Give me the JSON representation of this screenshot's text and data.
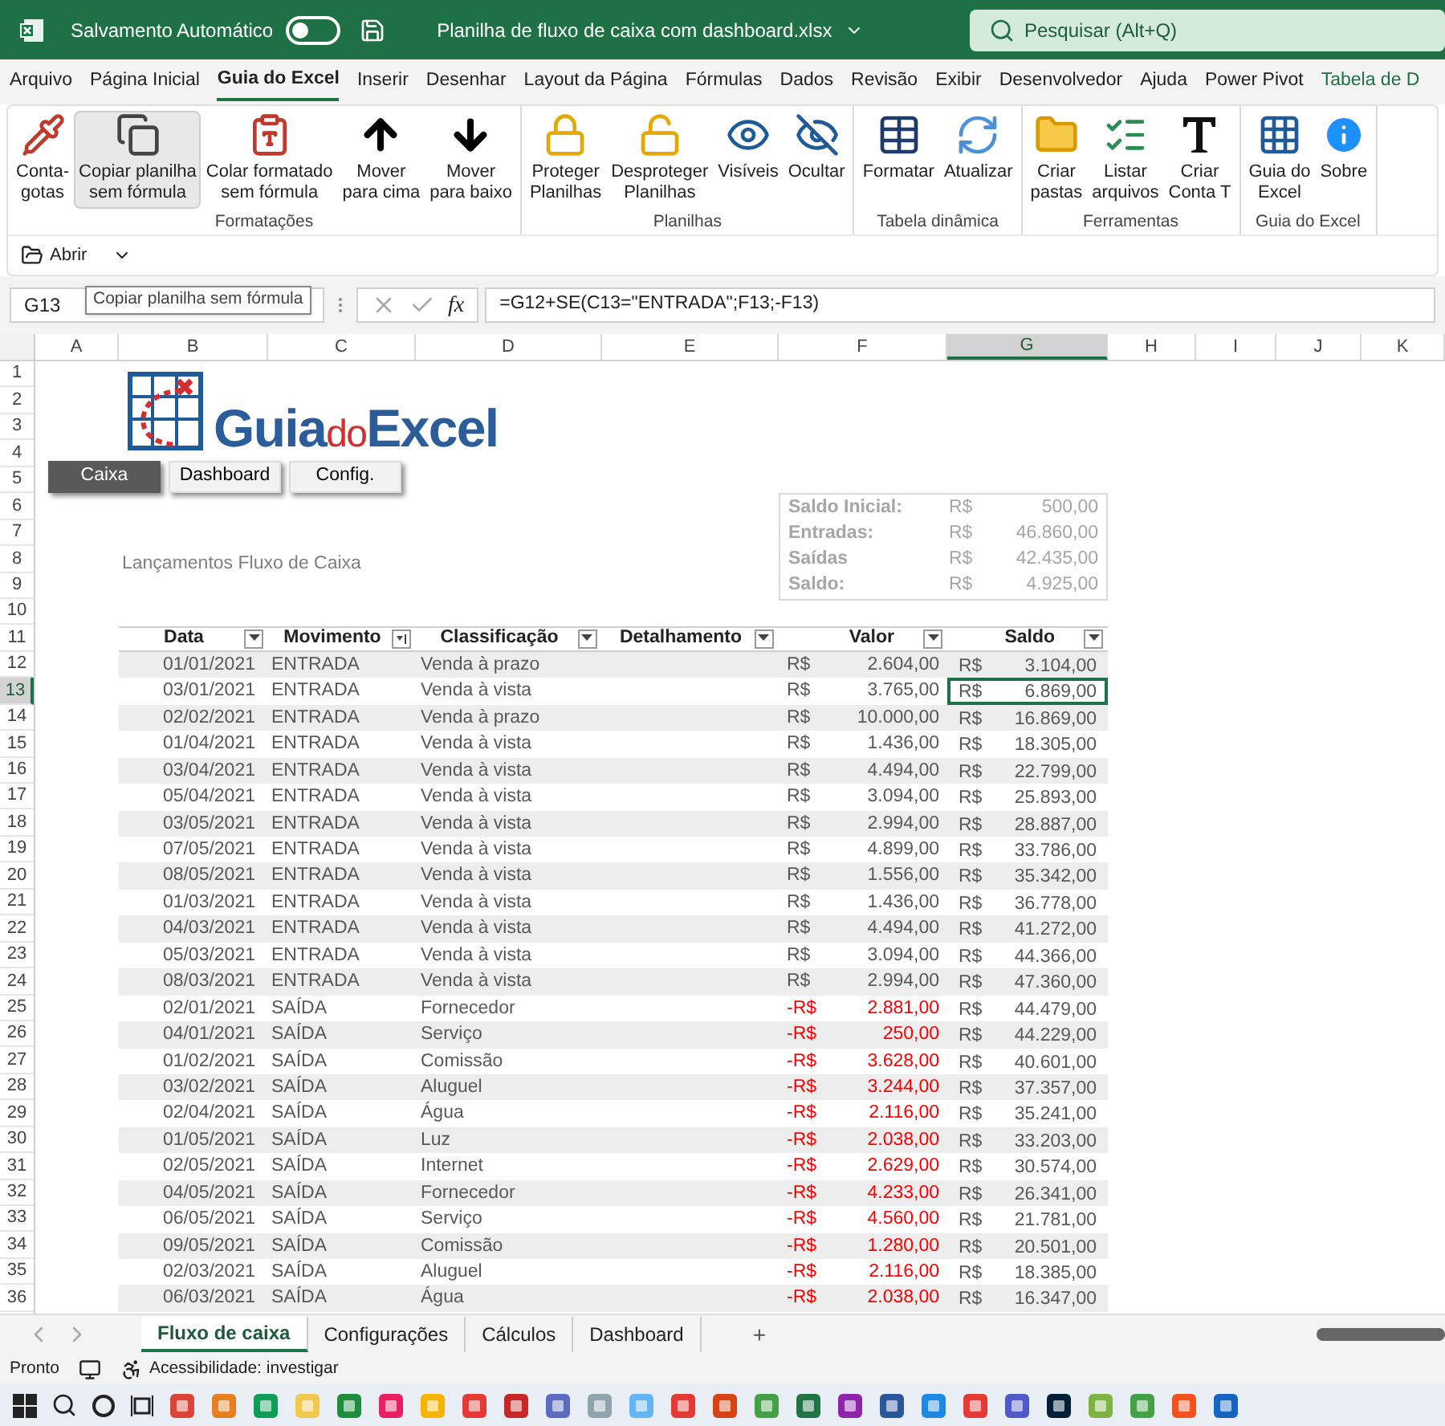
{
  "title_bar": {
    "autosave_label": "Salvamento Automático",
    "autosave_on": false,
    "file_title": "Planilha de fluxo de caixa com dashboard.xlsx",
    "search": {
      "placeholder": "Pesquisar (Alt+Q)"
    }
  },
  "menu_tabs": [
    {
      "label": "Arquivo",
      "selected": false,
      "kind": "normal"
    },
    {
      "label": "Página Inicial",
      "selected": false,
      "kind": "normal"
    },
    {
      "label": "Guia do Excel",
      "selected": true,
      "kind": "normal"
    },
    {
      "label": "Inserir",
      "selected": false,
      "kind": "normal"
    },
    {
      "label": "Desenhar",
      "selected": false,
      "kind": "normal"
    },
    {
      "label": "Layout da Página",
      "selected": false,
      "kind": "normal"
    },
    {
      "label": "Fórmulas",
      "selected": false,
      "kind": "normal"
    },
    {
      "label": "Dados",
      "selected": false,
      "kind": "normal"
    },
    {
      "label": "Revisão",
      "selected": false,
      "kind": "normal"
    },
    {
      "label": "Exibir",
      "selected": false,
      "kind": "normal"
    },
    {
      "label": "Desenvolvedor",
      "selected": false,
      "kind": "normal"
    },
    {
      "label": "Ajuda",
      "selected": false,
      "kind": "normal"
    },
    {
      "label": "Power Pivot",
      "selected": false,
      "kind": "normal"
    },
    {
      "label": "Tabela de D",
      "selected": false,
      "kind": "contextual"
    }
  ],
  "ribbon_groups": [
    {
      "name": "Formatações",
      "buttons": [
        {
          "lines": [
            "Conta-",
            "gotas"
          ],
          "highlighted": false
        },
        {
          "lines": [
            "Copiar planilha",
            "sem fórmula"
          ],
          "highlighted": true
        },
        {
          "lines": [
            "Colar formatado",
            "sem fórmula"
          ],
          "highlighted": false
        },
        {
          "lines": [
            "Mover",
            "para cima"
          ],
          "highlighted": false
        },
        {
          "lines": [
            "Mover",
            "para baixo"
          ],
          "highlighted": false
        }
      ]
    },
    {
      "name": "Planilhas",
      "buttons": [
        {
          "lines": [
            "Proteger",
            "Planilhas"
          ],
          "highlighted": false
        },
        {
          "lines": [
            "Desproteger",
            "Planilhas"
          ],
          "highlighted": false
        },
        {
          "lines": [
            "Visíveis"
          ],
          "highlighted": false
        },
        {
          "lines": [
            "Ocultar"
          ],
          "highlighted": false
        }
      ]
    },
    {
      "name": "Tabela dinâmica",
      "buttons": [
        {
          "lines": [
            "Formatar"
          ],
          "highlighted": false
        },
        {
          "lines": [
            "Atualizar"
          ],
          "highlighted": false
        }
      ]
    },
    {
      "name": "Ferramentas",
      "buttons": [
        {
          "lines": [
            "Criar",
            "pastas"
          ],
          "highlighted": false
        },
        {
          "lines": [
            "Listar",
            "arquivos"
          ],
          "highlighted": false
        },
        {
          "lines": [
            "Criar",
            "Conta T"
          ],
          "highlighted": false
        }
      ]
    },
    {
      "name": "Guia do Excel",
      "buttons": [
        {
          "lines": [
            "Guia do",
            "Excel"
          ],
          "highlighted": false
        },
        {
          "lines": [
            "Sobre"
          ],
          "highlighted": false
        }
      ]
    }
  ],
  "quick_access": {
    "open_label": "Abrir"
  },
  "tooltip": "Copiar planilha sem fórmula",
  "formula_bar": {
    "name_box": "G13",
    "fx": "fx",
    "formula": "=G12+SE(C13=\"ENTRADA\";F13;-F13)"
  },
  "columns": [
    {
      "label": "A",
      "selected": false
    },
    {
      "label": "B",
      "selected": false
    },
    {
      "label": "C",
      "selected": false
    },
    {
      "label": "D",
      "selected": false
    },
    {
      "label": "E",
      "selected": false
    },
    {
      "label": "F",
      "selected": false
    },
    {
      "label": "G",
      "selected": true
    },
    {
      "label": "H",
      "selected": false
    },
    {
      "label": "I",
      "selected": false
    },
    {
      "label": "J",
      "selected": false
    },
    {
      "label": "K",
      "selected": false
    }
  ],
  "row_numbers": [
    {
      "label": "1",
      "selected": false
    },
    {
      "label": "2",
      "selected": false
    },
    {
      "label": "3",
      "selected": false
    },
    {
      "label": "4",
      "selected": false
    },
    {
      "label": "5",
      "selected": false
    },
    {
      "label": "6",
      "selected": false
    },
    {
      "label": "7",
      "selected": false
    },
    {
      "label": "8",
      "selected": false
    },
    {
      "label": "9",
      "selected": false
    },
    {
      "label": "10",
      "selected": false
    },
    {
      "label": "11",
      "selected": false
    },
    {
      "label": "12",
      "selected": false
    },
    {
      "label": "13",
      "selected": true
    },
    {
      "label": "14",
      "selected": false
    },
    {
      "label": "15",
      "selected": false
    },
    {
      "label": "16",
      "selected": false
    },
    {
      "label": "17",
      "selected": false
    },
    {
      "label": "18",
      "selected": false
    },
    {
      "label": "19",
      "selected": false
    },
    {
      "label": "20",
      "selected": false
    },
    {
      "label": "21",
      "selected": false
    },
    {
      "label": "22",
      "selected": false
    },
    {
      "label": "23",
      "selected": false
    },
    {
      "label": "24",
      "selected": false
    },
    {
      "label": "25",
      "selected": false
    },
    {
      "label": "26",
      "selected": false
    },
    {
      "label": "27",
      "selected": false
    },
    {
      "label": "28",
      "selected": false
    },
    {
      "label": "29",
      "selected": false
    },
    {
      "label": "30",
      "selected": false
    },
    {
      "label": "31",
      "selected": false
    },
    {
      "label": "32",
      "selected": false
    },
    {
      "label": "33",
      "selected": false
    },
    {
      "label": "34",
      "selected": false
    },
    {
      "label": "35",
      "selected": false
    },
    {
      "label": "36",
      "selected": false
    }
  ],
  "logo": {
    "parts": [
      "Guia",
      "do",
      "Excel"
    ]
  },
  "nav_buttons": [
    {
      "label": "Caixa",
      "selected": true
    },
    {
      "label": "Dashboard",
      "selected": false
    },
    {
      "label": "Config.",
      "selected": false
    }
  ],
  "section_title": "Lançamentos Fluxo de Caixa",
  "summary": [
    {
      "label": "Saldo Inicial:",
      "currency": "R$",
      "value": "500,00"
    },
    {
      "label": "Entradas:",
      "currency": "R$",
      "value": "46.860,00"
    },
    {
      "label": "Saídas",
      "currency": "R$",
      "value": "42.435,00"
    },
    {
      "label": "Saldo:",
      "currency": "R$",
      "value": "4.925,00"
    }
  ],
  "table": {
    "columns": [
      {
        "label": "Data",
        "sorted": false
      },
      {
        "label": "Movimento",
        "sorted": true
      },
      {
        "label": "Classificação",
        "sorted": false
      },
      {
        "label": "Detalhamento",
        "sorted": false
      },
      {
        "label": "Valor",
        "sorted": false
      },
      {
        "label": "Saldo",
        "sorted": false
      }
    ],
    "rows": [
      {
        "date": "01/01/2021",
        "movement": "ENTRADA",
        "classification": "Venda à prazo",
        "currency": "R$",
        "value": "2.604,00",
        "negative": false,
        "saldo_currency": "R$",
        "saldo": "3.104,00",
        "selected": false
      },
      {
        "date": "03/01/2021",
        "movement": "ENTRADA",
        "classification": "Venda à vista",
        "currency": "R$",
        "value": "3.765,00",
        "negative": false,
        "saldo_currency": "R$",
        "saldo": "6.869,00",
        "selected": true
      },
      {
        "date": "02/02/2021",
        "movement": "ENTRADA",
        "classification": "Venda à prazo",
        "currency": "R$",
        "value": "10.000,00",
        "negative": false,
        "saldo_currency": "R$",
        "saldo": "16.869,00",
        "selected": false
      },
      {
        "date": "01/04/2021",
        "movement": "ENTRADA",
        "classification": "Venda à vista",
        "currency": "R$",
        "value": "1.436,00",
        "negative": false,
        "saldo_currency": "R$",
        "saldo": "18.305,00",
        "selected": false
      },
      {
        "date": "03/04/2021",
        "movement": "ENTRADA",
        "classification": "Venda à vista",
        "currency": "R$",
        "value": "4.494,00",
        "negative": false,
        "saldo_currency": "R$",
        "saldo": "22.799,00",
        "selected": false
      },
      {
        "date": "05/04/2021",
        "movement": "ENTRADA",
        "classification": "Venda à vista",
        "currency": "R$",
        "value": "3.094,00",
        "negative": false,
        "saldo_currency": "R$",
        "saldo": "25.893,00",
        "selected": false
      },
      {
        "date": "03/05/2021",
        "movement": "ENTRADA",
        "classification": "Venda à vista",
        "currency": "R$",
        "value": "2.994,00",
        "negative": false,
        "saldo_currency": "R$",
        "saldo": "28.887,00",
        "selected": false
      },
      {
        "date": "07/05/2021",
        "movement": "ENTRADA",
        "classification": "Venda à vista",
        "currency": "R$",
        "value": "4.899,00",
        "negative": false,
        "saldo_currency": "R$",
        "saldo": "33.786,00",
        "selected": false
      },
      {
        "date": "08/05/2021",
        "movement": "ENTRADA",
        "classification": "Venda à vista",
        "currency": "R$",
        "value": "1.556,00",
        "negative": false,
        "saldo_currency": "R$",
        "saldo": "35.342,00",
        "selected": false
      },
      {
        "date": "01/03/2021",
        "movement": "ENTRADA",
        "classification": "Venda à vista",
        "currency": "R$",
        "value": "1.436,00",
        "negative": false,
        "saldo_currency": "R$",
        "saldo": "36.778,00",
        "selected": false
      },
      {
        "date": "04/03/2021",
        "movement": "ENTRADA",
        "classification": "Venda à vista",
        "currency": "R$",
        "value": "4.494,00",
        "negative": false,
        "saldo_currency": "R$",
        "saldo": "41.272,00",
        "selected": false
      },
      {
        "date": "05/03/2021",
        "movement": "ENTRADA",
        "classification": "Venda à vista",
        "currency": "R$",
        "value": "3.094,00",
        "negative": false,
        "saldo_currency": "R$",
        "saldo": "44.366,00",
        "selected": false
      },
      {
        "date": "08/03/2021",
        "movement": "ENTRADA",
        "classification": "Venda à vista",
        "currency": "R$",
        "value": "2.994,00",
        "negative": false,
        "saldo_currency": "R$",
        "saldo": "47.360,00",
        "selected": false
      },
      {
        "date": "02/01/2021",
        "movement": "SAÍDA",
        "classification": "Fornecedor",
        "currency": "-R$",
        "value": "2.881,00",
        "negative": true,
        "saldo_currency": "R$",
        "saldo": "44.479,00",
        "selected": false
      },
      {
        "date": "04/01/2021",
        "movement": "SAÍDA",
        "classification": "Serviço",
        "currency": "-R$",
        "value": "250,00",
        "negative": true,
        "saldo_currency": "R$",
        "saldo": "44.229,00",
        "selected": false
      },
      {
        "date": "01/02/2021",
        "movement": "SAÍDA",
        "classification": "Comissão",
        "currency": "-R$",
        "value": "3.628,00",
        "negative": true,
        "saldo_currency": "R$",
        "saldo": "40.601,00",
        "selected": false
      },
      {
        "date": "03/02/2021",
        "movement": "SAÍDA",
        "classification": "Aluguel",
        "currency": "-R$",
        "value": "3.244,00",
        "negative": true,
        "saldo_currency": "R$",
        "saldo": "37.357,00",
        "selected": false
      },
      {
        "date": "02/04/2021",
        "movement": "SAÍDA",
        "classification": "Água",
        "currency": "-R$",
        "value": "2.116,00",
        "negative": true,
        "saldo_currency": "R$",
        "saldo": "35.241,00",
        "selected": false
      },
      {
        "date": "01/05/2021",
        "movement": "SAÍDA",
        "classification": "Luz",
        "currency": "-R$",
        "value": "2.038,00",
        "negative": true,
        "saldo_currency": "R$",
        "saldo": "33.203,00",
        "selected": false
      },
      {
        "date": "02/05/2021",
        "movement": "SAÍDA",
        "classification": "Internet",
        "currency": "-R$",
        "value": "2.629,00",
        "negative": true,
        "saldo_currency": "R$",
        "saldo": "30.574,00",
        "selected": false
      },
      {
        "date": "04/05/2021",
        "movement": "SAÍDA",
        "classification": "Fornecedor",
        "currency": "-R$",
        "value": "4.233,00",
        "negative": true,
        "saldo_currency": "R$",
        "saldo": "26.341,00",
        "selected": false
      },
      {
        "date": "06/05/2021",
        "movement": "SAÍDA",
        "classification": "Serviço",
        "currency": "-R$",
        "value": "4.560,00",
        "negative": true,
        "saldo_currency": "R$",
        "saldo": "21.781,00",
        "selected": false
      },
      {
        "date": "09/05/2021",
        "movement": "SAÍDA",
        "classification": "Comissão",
        "currency": "-R$",
        "value": "1.280,00",
        "negative": true,
        "saldo_currency": "R$",
        "saldo": "20.501,00",
        "selected": false
      },
      {
        "date": "02/03/2021",
        "movement": "SAÍDA",
        "classification": "Aluguel",
        "currency": "-R$",
        "value": "2.116,00",
        "negative": true,
        "saldo_currency": "R$",
        "saldo": "18.385,00",
        "selected": false
      },
      {
        "date": "06/03/2021",
        "movement": "SAÍDA",
        "classification": "Água",
        "currency": "-R$",
        "value": "2.038,00",
        "negative": true,
        "saldo_currency": "R$",
        "saldo": "16.347,00",
        "selected": false
      }
    ]
  },
  "sheet_tabs": [
    {
      "label": "Fluxo de caixa",
      "selected": true
    },
    {
      "label": "Configurações",
      "selected": false
    },
    {
      "label": "Cálculos",
      "selected": false
    },
    {
      "label": "Dashboard",
      "selected": false
    }
  ],
  "add_sheet": "+",
  "status_bar": {
    "ready": "Pronto",
    "accessibility": "Acessibilidade: investigar"
  }
}
